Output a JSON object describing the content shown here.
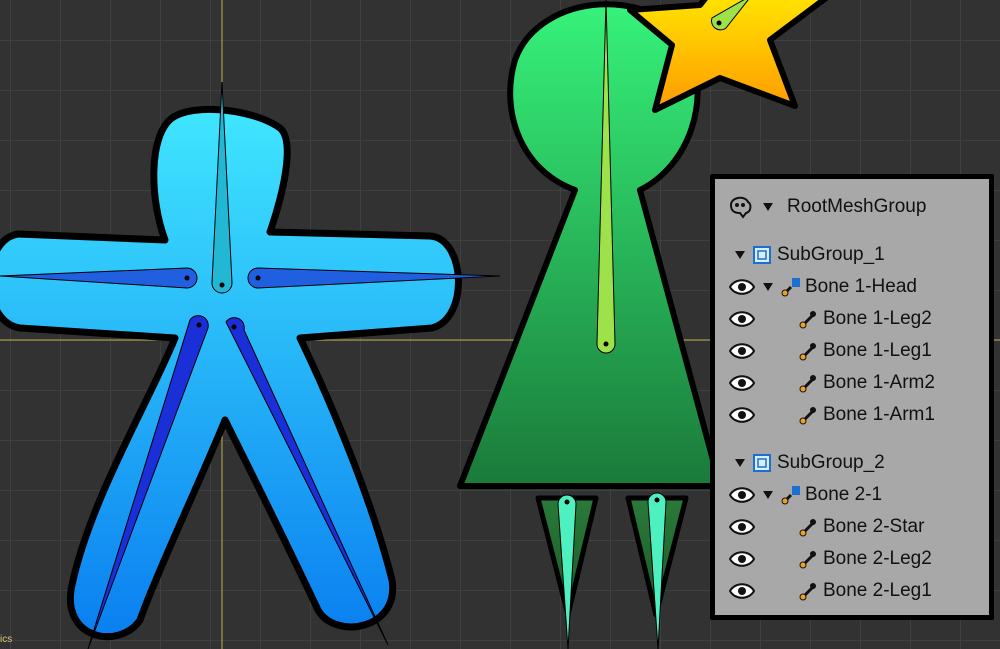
{
  "viewport": {
    "corner_label": "ics",
    "colors": {
      "background": "#323232",
      "grid": "#404040",
      "axis": "#b9b04a",
      "blue_mesh": "#22b6f2",
      "green_mesh": "#2fc96a",
      "star_mesh": "#ffc60a",
      "blue_bone": "#1b2fd8",
      "green_bone": "#9de24a",
      "leg_bone": "#4ff0c0"
    }
  },
  "outliner": {
    "root": {
      "label": "RootMeshGroup",
      "icon": "ghost-visibility-icon"
    },
    "groups": [
      {
        "label": "SubGroup_1",
        "icon": "mesh-group-icon",
        "parent_bone": {
          "label": "Bone 1-Head",
          "icon": "bone-icon"
        },
        "children": [
          {
            "label": "Bone 1-Leg2"
          },
          {
            "label": "Bone 1-Leg1"
          },
          {
            "label": "Bone 1-Arm2"
          },
          {
            "label": "Bone 1-Arm1"
          }
        ]
      },
      {
        "label": "SubGroup_2",
        "icon": "mesh-group-icon",
        "parent_bone": {
          "label": "Bone 2-1",
          "icon": "bone-icon"
        },
        "children": [
          {
            "label": "Bone 2-Star"
          },
          {
            "label": "Bone 2-Leg2"
          },
          {
            "label": "Bone 2-Leg1"
          }
        ]
      }
    ]
  }
}
